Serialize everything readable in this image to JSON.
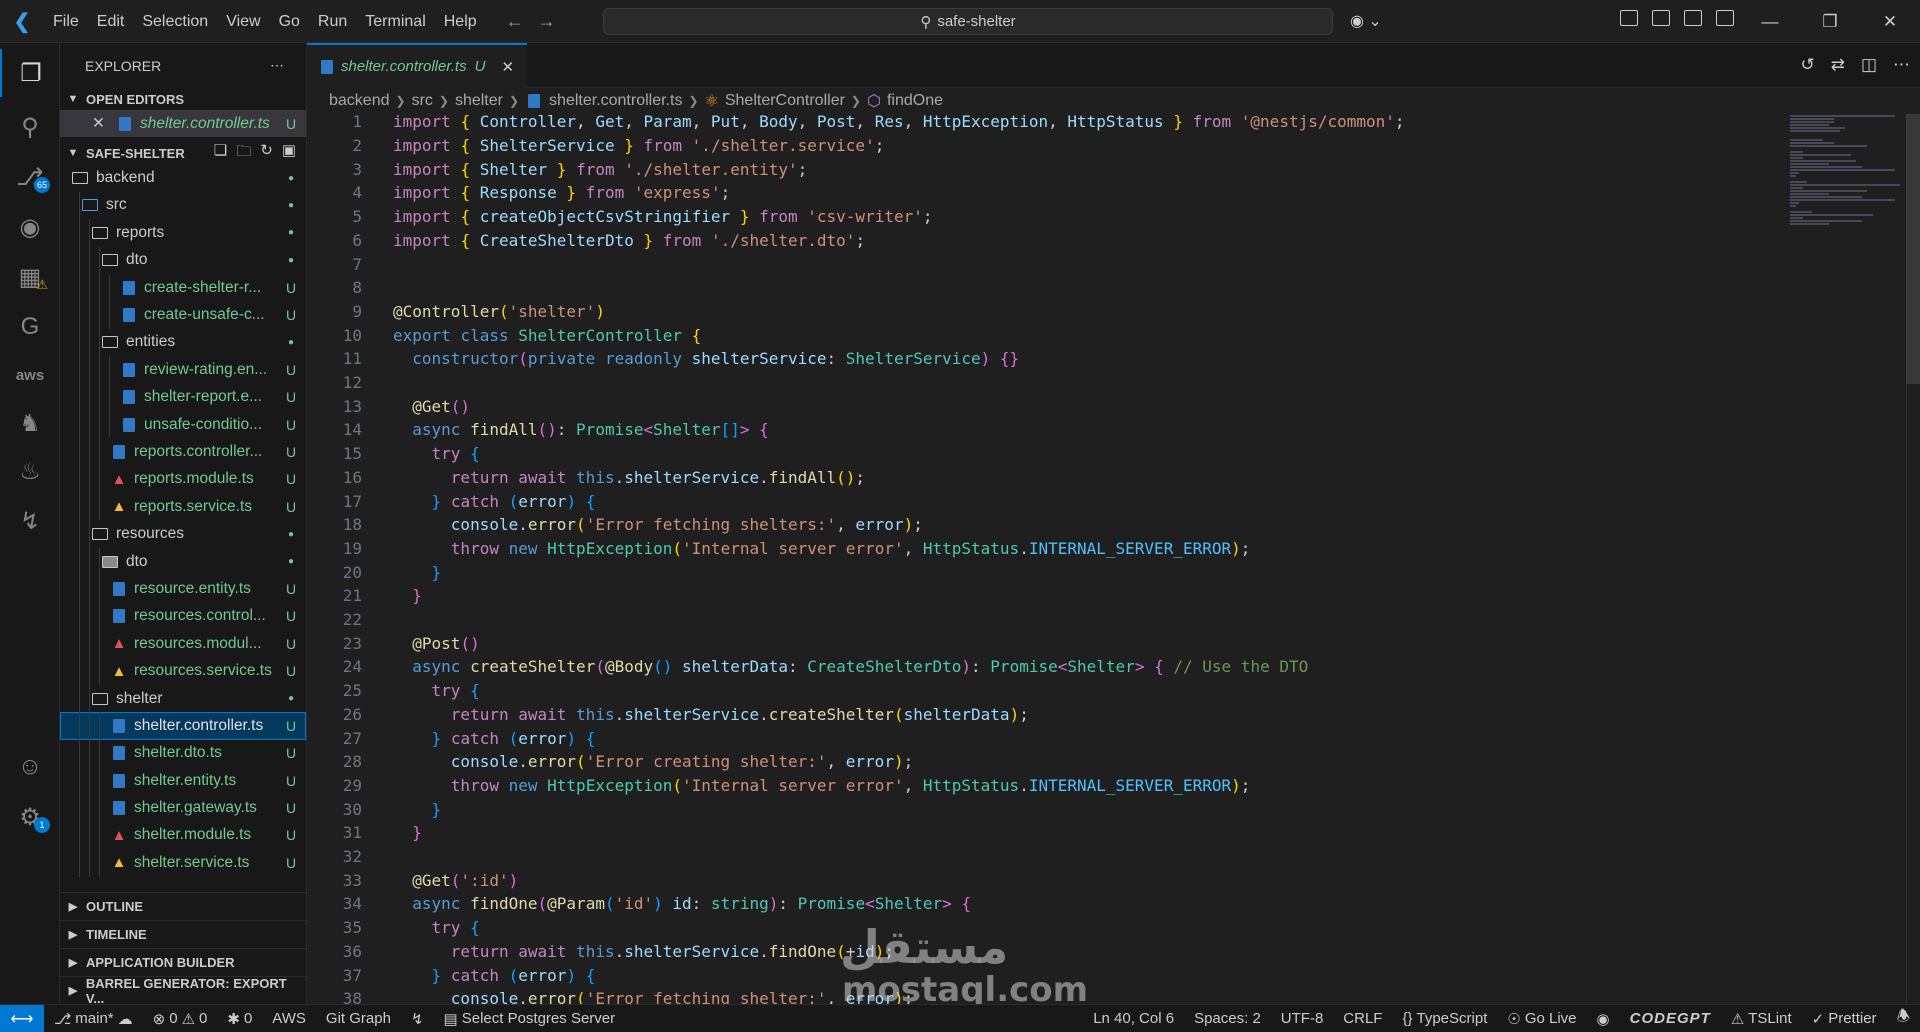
{
  "menu": [
    "File",
    "Edit",
    "Selection",
    "View",
    "Go",
    "Run",
    "Terminal",
    "Help"
  ],
  "search": {
    "text": "safe-shelter"
  },
  "activity": {
    "scm_badge": "65",
    "settings_badge": "1",
    "aws_label": "aws"
  },
  "sidebar": {
    "title": "EXPLORER",
    "open_editors_label": "OPEN EDITORS",
    "open_editor": {
      "name": "shelter.controller.ts",
      "status": "U"
    },
    "project_label": "SAFE-SHELTER",
    "tree": [
      {
        "name": "backend",
        "type": "folder",
        "depth": 0,
        "status": "dot"
      },
      {
        "name": "src",
        "type": "folder-src",
        "depth": 1,
        "status": "dot"
      },
      {
        "name": "reports",
        "type": "folder",
        "depth": 2,
        "status": "dot"
      },
      {
        "name": "dto",
        "type": "folder",
        "depth": 3,
        "status": "dot"
      },
      {
        "name": "create-shelter-r...",
        "type": "ts",
        "depth": 4,
        "status": "U"
      },
      {
        "name": "create-unsafe-c...",
        "type": "ts",
        "depth": 4,
        "status": "U"
      },
      {
        "name": "entities",
        "type": "folder",
        "depth": 3,
        "status": "dot"
      },
      {
        "name": "review-rating.en...",
        "type": "ts",
        "depth": 4,
        "status": "U"
      },
      {
        "name": "shelter-report.e...",
        "type": "ts",
        "depth": 4,
        "status": "U"
      },
      {
        "name": "unsafe-conditio...",
        "type": "ts",
        "depth": 4,
        "status": "U"
      },
      {
        "name": "reports.controller...",
        "type": "ts",
        "depth": 3,
        "status": "U"
      },
      {
        "name": "reports.module.ts",
        "type": "ng",
        "depth": 3,
        "status": "U"
      },
      {
        "name": "reports.service.ts",
        "type": "ngy",
        "depth": 3,
        "status": "U"
      },
      {
        "name": "resources",
        "type": "folder",
        "depth": 2,
        "status": "dot"
      },
      {
        "name": "dto",
        "type": "folder-filled",
        "depth": 3,
        "status": "dot"
      },
      {
        "name": "resource.entity.ts",
        "type": "ts",
        "depth": 3,
        "status": "U"
      },
      {
        "name": "resources.control...",
        "type": "ts",
        "depth": 3,
        "status": "U"
      },
      {
        "name": "resources.modul...",
        "type": "ng",
        "depth": 3,
        "status": "U"
      },
      {
        "name": "resources.service.ts",
        "type": "ngy",
        "depth": 3,
        "status": "U"
      },
      {
        "name": "shelter",
        "type": "folder",
        "depth": 2,
        "status": "dot"
      },
      {
        "name": "shelter.controller.ts",
        "type": "ts",
        "depth": 3,
        "status": "U",
        "selected": true
      },
      {
        "name": "shelter.dto.ts",
        "type": "ts",
        "depth": 3,
        "status": "U"
      },
      {
        "name": "shelter.entity.ts",
        "type": "ts",
        "depth": 3,
        "status": "U"
      },
      {
        "name": "shelter.gateway.ts",
        "type": "ts",
        "depth": 3,
        "status": "U"
      },
      {
        "name": "shelter.module.ts",
        "type": "ng",
        "depth": 3,
        "status": "U"
      },
      {
        "name": "shelter.service.ts",
        "type": "ngy",
        "depth": 3,
        "status": "U"
      }
    ],
    "bottom_sections": [
      "OUTLINE",
      "TIMELINE",
      "APPLICATION BUILDER",
      "BARREL GENERATOR: EXPORT V..."
    ]
  },
  "tab": {
    "label": "shelter.controller.ts",
    "status": "U"
  },
  "breadcrumb": {
    "parts": [
      "backend",
      "src",
      "shelter",
      "shelter.controller.ts",
      "ShelterController",
      "findOne"
    ]
  },
  "code": [
    "1",
    "2",
    "3",
    "4",
    "5",
    "6",
    "7",
    "8",
    "9",
    "10",
    "11",
    "12",
    "13",
    "14",
    "15",
    "16",
    "17",
    "18",
    "19",
    "20",
    "21",
    "22",
    "23",
    "24",
    "25",
    "26",
    "27",
    "28",
    "29",
    "30",
    "31",
    "32",
    "33",
    "34",
    "35",
    "36",
    "37",
    "38"
  ],
  "watermark": {
    "arabic": "مستقل",
    "url": "mostaql.com"
  },
  "status": {
    "branch": "main*",
    "errors": "0",
    "warnings": "0",
    "radio": "0",
    "aws": "AWS",
    "git_graph": "Git Graph",
    "postgres": "Select Postgres Server",
    "cursor": "Ln 40, Col 6",
    "spaces": "Spaces: 2",
    "encoding": "UTF-8",
    "eol": "CRLF",
    "language": "TypeScript",
    "golive": "Go Live",
    "codegpt": "CODEGPT",
    "tslint": "TSLint",
    "prettier": "Prettier"
  }
}
